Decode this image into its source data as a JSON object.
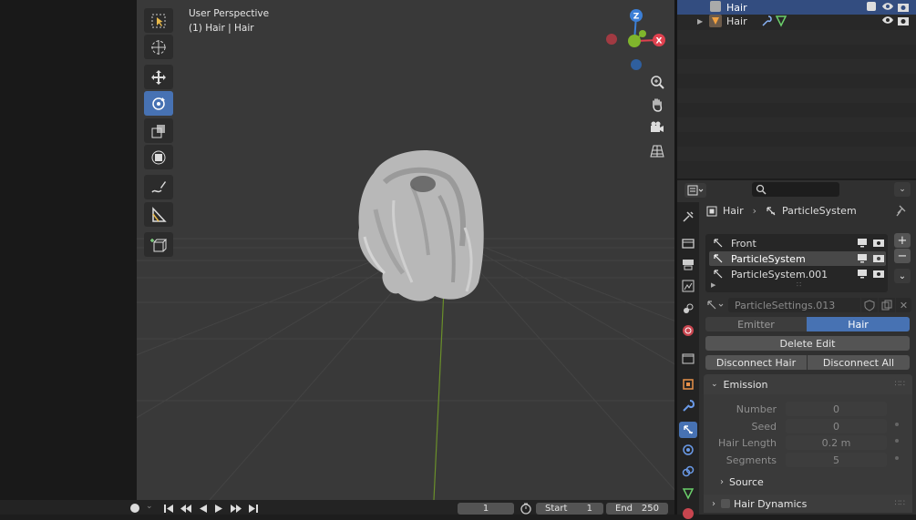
{
  "viewport": {
    "title": "User Perspective",
    "subtitle": "(1) Hair | Hair",
    "gizmo": {
      "z": "Z",
      "x": "X"
    }
  },
  "outliner": {
    "rows": [
      {
        "label": "Hair"
      },
      {
        "label": "Hair"
      }
    ]
  },
  "properties": {
    "search_placeholder": "",
    "breadcrumb": {
      "object": "Hair",
      "system": "ParticleSystem"
    },
    "particle_systems": [
      {
        "label": "Front"
      },
      {
        "label": "ParticleSystem"
      },
      {
        "label": "ParticleSystem.001"
      }
    ],
    "settings_name": "ParticleSettings.013",
    "type_tabs": {
      "emitter": "Emitter",
      "hair": "Hair"
    },
    "delete_edit": "Delete Edit",
    "disconnect_hair": "Disconnect Hair",
    "disconnect_all": "Disconnect All",
    "emission": {
      "title": "Emission",
      "fields": [
        {
          "label": "Number",
          "value": "0"
        },
        {
          "label": "Seed",
          "value": "0"
        },
        {
          "label": "Hair Length",
          "value": "0.2 m"
        },
        {
          "label": "Segments",
          "value": "5"
        }
      ],
      "source": "Source"
    },
    "hair_dynamics": "Hair Dynamics"
  },
  "timeline": {
    "current_frame": "1",
    "start_label": "Start",
    "start_value": "1",
    "end_label": "End",
    "end_value": "250"
  },
  "colors": {
    "accent": "#4772b3",
    "viewport_bg": "#393939",
    "gizmo_x": "#e0414f",
    "gizmo_y": "#7fb52c",
    "gizmo_z": "#3c7fd6"
  }
}
